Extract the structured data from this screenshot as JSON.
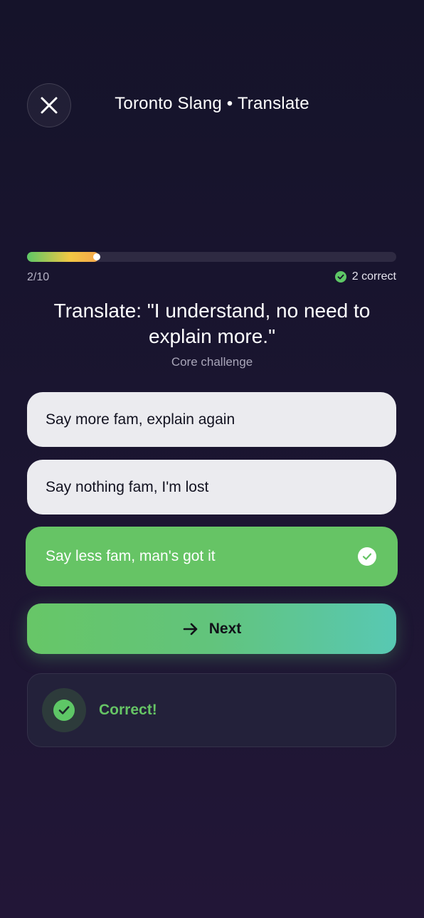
{
  "header": {
    "title": "Toronto Slang • Translate",
    "close_icon": "close-icon"
  },
  "progress": {
    "current": 2,
    "total": 10,
    "fraction": 0.195,
    "label": "2/10",
    "correct_label": "2 correct"
  },
  "question": {
    "text": "Translate: \"I understand, no need to explain more.\"",
    "subtitle": "Core challenge"
  },
  "options": [
    {
      "label": "Say more fam, explain again",
      "state": "default"
    },
    {
      "label": "Say nothing fam, I'm lost",
      "state": "default"
    },
    {
      "label": "Say less fam, man's got it",
      "state": "correct"
    }
  ],
  "next_button": {
    "label": "Next",
    "icon": "arrow-right-icon"
  },
  "feedback": {
    "label": "Correct!",
    "icon": "check-circle-icon"
  },
  "colors": {
    "correct_green": "#66c465",
    "option_bg": "#ebebef",
    "background": "#1a1530"
  }
}
